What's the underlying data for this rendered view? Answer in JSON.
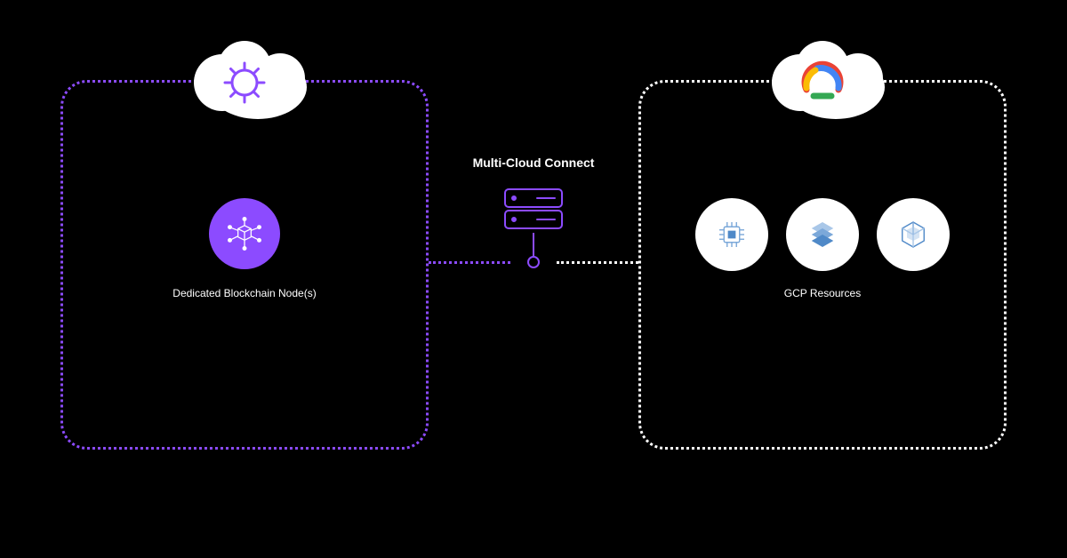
{
  "left_panel": {
    "cloud_icon": "gear-cloud-icon",
    "node_icon": "blockchain-cube-icon",
    "label": "Dedicated Blockchain Node(s)",
    "accent": "#8c4bff"
  },
  "center": {
    "label": "Multi-Cloud Connect",
    "icon": "server-rack-icon"
  },
  "right_panel": {
    "cloud_icon": "google-cloud-icon",
    "label": "GCP Resources",
    "resources": [
      {
        "icon": "compute-chip-icon"
      },
      {
        "icon": "layered-stack-icon"
      },
      {
        "icon": "kubernetes-cube-icon"
      }
    ]
  }
}
